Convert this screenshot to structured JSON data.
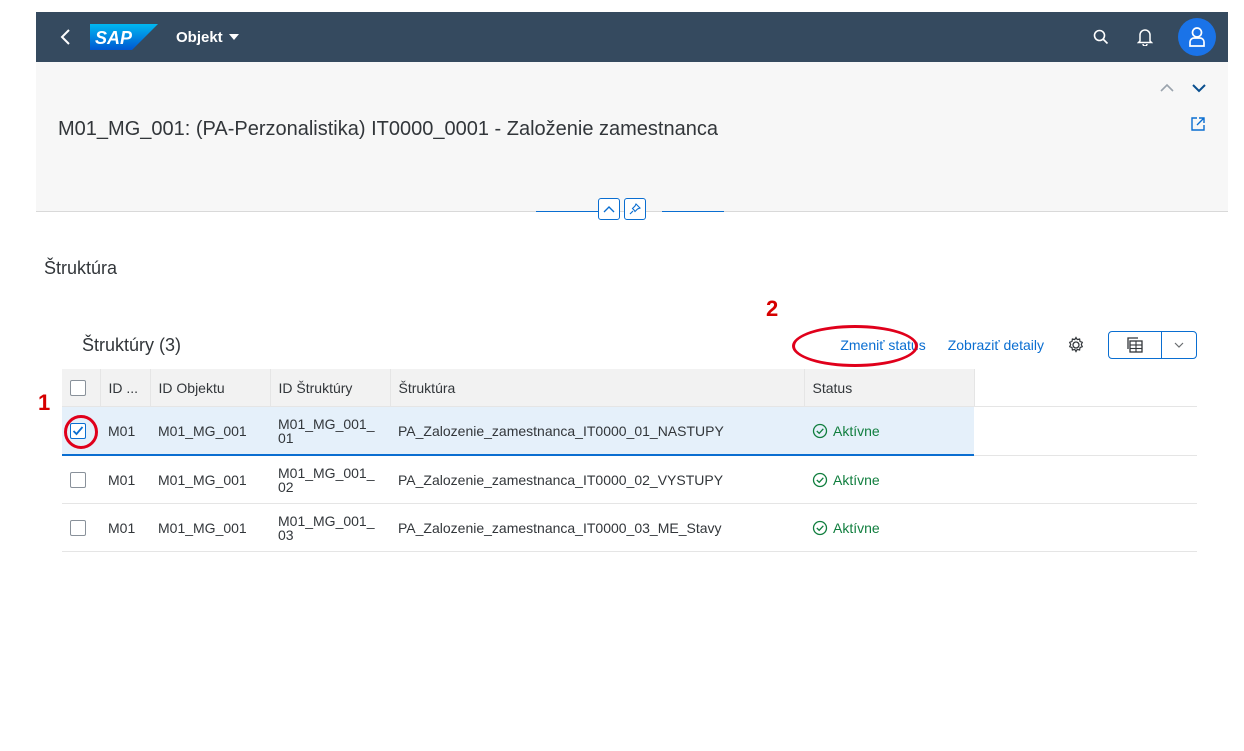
{
  "shell": {
    "logo_text": "SAP",
    "app_title": "Objekt",
    "colors": {
      "bar": "#354a5f",
      "avatar": "#1a73e8"
    }
  },
  "header": {
    "object_title": "M01_MG_001: (PA-Perzonalistika) IT0000_0001 - Založenie zamestnanca"
  },
  "section": {
    "title": "Štruktúra"
  },
  "table": {
    "title": "Štruktúry (3)",
    "actions": {
      "change_status": "Zmeniť status",
      "show_details": "Zobraziť detaily"
    },
    "columns": [
      "ID ...",
      "ID Objektu",
      "ID Štruktúry",
      "Štruktúra",
      "Status"
    ],
    "rows": [
      {
        "id": "M01",
        "object_id": "M01_MG_001",
        "struct_id_a": "M01_MG_001_",
        "struct_id_b": "01",
        "structure": "PA_Zalozenie_zamestnanca_IT0000_01_NASTUPY",
        "status": "Aktívne",
        "selected": true
      },
      {
        "id": "M01",
        "object_id": "M01_MG_001",
        "struct_id_a": "M01_MG_001_",
        "struct_id_b": "02",
        "structure": "PA_Zalozenie_zamestnanca_IT0000_02_VYSTUPY",
        "status": "Aktívne",
        "selected": false
      },
      {
        "id": "M01",
        "object_id": "M01_MG_001",
        "struct_id_a": "M01_MG_001_",
        "struct_id_b": "03",
        "structure": "PA_Zalozenie_zamestnanca_IT0000_03_ME_Stavy",
        "status": "Aktívne",
        "selected": false
      }
    ],
    "status_color": "#107e3e"
  },
  "annotations": {
    "step1": "1",
    "step2": "2",
    "color": "#e0001b"
  }
}
